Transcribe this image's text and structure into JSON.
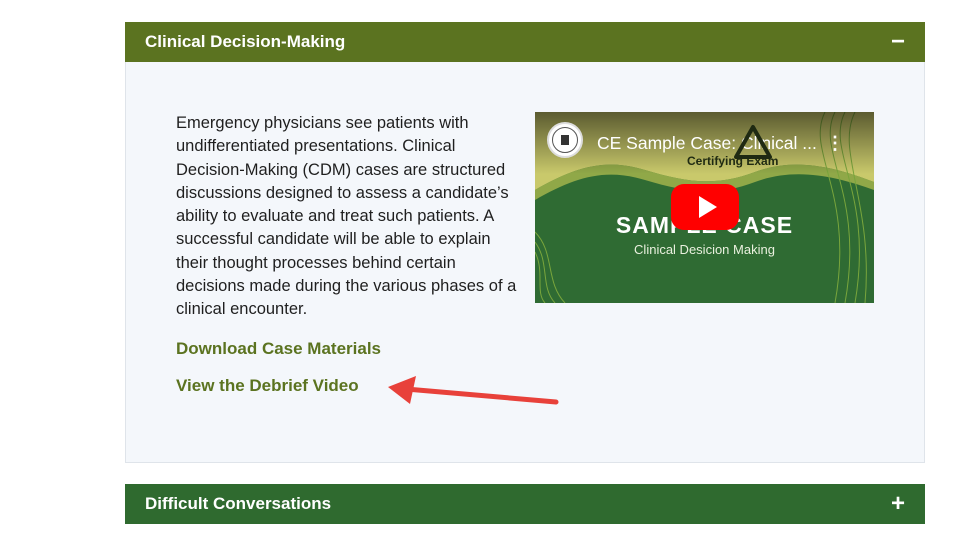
{
  "accordion1": {
    "title": "Clinical Decision-Making",
    "toggle": "−",
    "description": "Emergency physicians see patients with undifferentiated presentations. Clinical Decision-Making (CDM) cases are structured discussions designed to assess a candidate’s ability to evaluate and treat such patients. A successful candidate will be able to explain their thought processes behind certain decisions made during the various phases of a clinical encounter.",
    "links": [
      "Download Case Materials",
      "View the Debrief Video"
    ],
    "video": {
      "title": "CE Sample Case: Clinical ...",
      "more_icon": "⋮",
      "badge": "Certifying Exam",
      "big_text": "SAMPLE CASE",
      "sub_text": "Clinical Desicion Making",
      "play_icon": "youtube-play-icon"
    }
  },
  "accordion2": {
    "title": "Difficult Conversations",
    "toggle": "+"
  },
  "colors": {
    "header1": "#5b7320",
    "header2": "#2f6a2f",
    "link": "#5b7320",
    "arrow": "#e8413a"
  }
}
